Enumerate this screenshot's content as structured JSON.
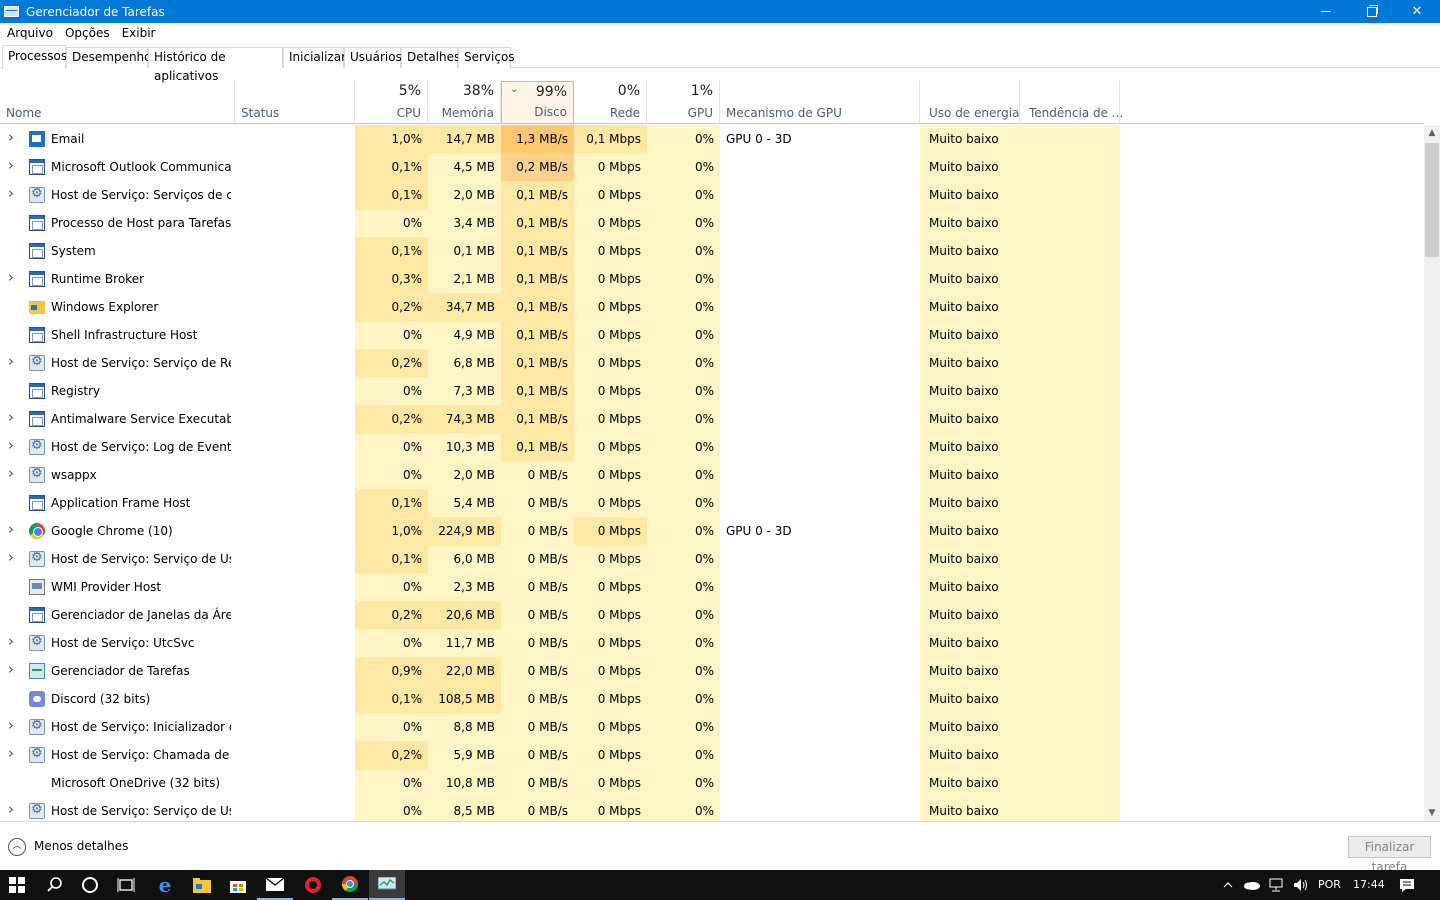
{
  "window": {
    "title": "Gerenciador de Tarefas"
  },
  "menu": [
    "Arquivo",
    "Opções",
    "Exibir"
  ],
  "tabs": [
    "Processos",
    "Desempenho",
    "Histórico de aplicativos",
    "Inicializar",
    "Usuários",
    "Detalhes",
    "Serviços"
  ],
  "active_tab": "Processos",
  "columns": {
    "name": "Nome",
    "status": "Status",
    "cpu": {
      "pct": "5%",
      "label": "CPU"
    },
    "memory": {
      "pct": "38%",
      "label": "Memória"
    },
    "disk": {
      "pct": "99%",
      "label": "Disco"
    },
    "network": {
      "pct": "0%",
      "label": "Rede"
    },
    "gpu": {
      "pct": "1%",
      "label": "GPU"
    },
    "gpu_engine": "Mecanismo de GPU",
    "power": "Uso de energia",
    "power_trend": "Tendência de ..."
  },
  "processes": [
    {
      "name": "Email",
      "icon": "mail-icon",
      "exp": true,
      "cpu": "1,0%",
      "mem": "14,7 MB",
      "disk": "1,3 MB/s",
      "net": "0,1 Mbps",
      "gpu": "0%",
      "engine": "GPU 0 - 3D",
      "power": "Muito baixo",
      "heat": {
        "cpu": 2,
        "mem": 2,
        "disk": 4,
        "net": 2
      }
    },
    {
      "name": "Microsoft Outlook Communica...",
      "icon": "window-icon",
      "exp": true,
      "cpu": "0,1%",
      "mem": "4,5 MB",
      "disk": "0,2 MB/s",
      "net": "0 Mbps",
      "gpu": "0%",
      "engine": "",
      "power": "Muito baixo",
      "heat": {
        "cpu": 2,
        "mem": 1,
        "disk": 3,
        "net": 1
      }
    },
    {
      "name": "Host de Serviço: Serviços de cri...",
      "icon": "gear-icon",
      "exp": true,
      "cpu": "0,1%",
      "mem": "2,0 MB",
      "disk": "0,1 MB/s",
      "net": "0 Mbps",
      "gpu": "0%",
      "engine": "",
      "power": "Muito baixo",
      "heat": {
        "cpu": 2,
        "mem": 1,
        "disk": 2,
        "net": 1
      }
    },
    {
      "name": "Processo de Host para Tarefas d...",
      "icon": "window-icon",
      "exp": false,
      "cpu": "0%",
      "mem": "3,4 MB",
      "disk": "0,1 MB/s",
      "net": "0 Mbps",
      "gpu": "0%",
      "engine": "",
      "power": "Muito baixo",
      "heat": {
        "cpu": 1,
        "mem": 1,
        "disk": 2,
        "net": 1
      }
    },
    {
      "name": "System",
      "icon": "window-icon",
      "exp": false,
      "cpu": "0,1%",
      "mem": "0,1 MB",
      "disk": "0,1 MB/s",
      "net": "0 Mbps",
      "gpu": "0%",
      "engine": "",
      "power": "Muito baixo",
      "heat": {
        "cpu": 2,
        "mem": 1,
        "disk": 2,
        "net": 1
      }
    },
    {
      "name": "Runtime Broker",
      "icon": "window-icon",
      "exp": true,
      "cpu": "0,3%",
      "mem": "2,1 MB",
      "disk": "0,1 MB/s",
      "net": "0 Mbps",
      "gpu": "0%",
      "engine": "",
      "power": "Muito baixo",
      "heat": {
        "cpu": 2,
        "mem": 1,
        "disk": 2,
        "net": 1
      }
    },
    {
      "name": "Windows Explorer",
      "icon": "folder-icon",
      "exp": false,
      "cpu": "0,2%",
      "mem": "34,7 MB",
      "disk": "0,1 MB/s",
      "net": "0 Mbps",
      "gpu": "0%",
      "engine": "",
      "power": "Muito baixo",
      "heat": {
        "cpu": 2,
        "mem": 2,
        "disk": 2,
        "net": 1
      }
    },
    {
      "name": "Shell Infrastructure Host",
      "icon": "window-icon",
      "exp": false,
      "cpu": "0%",
      "mem": "4,9 MB",
      "disk": "0,1 MB/s",
      "net": "0 Mbps",
      "gpu": "0%",
      "engine": "",
      "power": "Muito baixo",
      "heat": {
        "cpu": 1,
        "mem": 1,
        "disk": 2,
        "net": 1
      }
    },
    {
      "name": "Host de Serviço: Serviço de Rep...",
      "icon": "gear-icon",
      "exp": true,
      "cpu": "0,2%",
      "mem": "6,8 MB",
      "disk": "0,1 MB/s",
      "net": "0 Mbps",
      "gpu": "0%",
      "engine": "",
      "power": "Muito baixo",
      "heat": {
        "cpu": 2,
        "mem": 1,
        "disk": 2,
        "net": 1
      }
    },
    {
      "name": "Registry",
      "icon": "window-icon",
      "exp": false,
      "cpu": "0%",
      "mem": "7,3 MB",
      "disk": "0,1 MB/s",
      "net": "0 Mbps",
      "gpu": "0%",
      "engine": "",
      "power": "Muito baixo",
      "heat": {
        "cpu": 1,
        "mem": 1,
        "disk": 2,
        "net": 1
      }
    },
    {
      "name": "Antimalware Service Executable",
      "icon": "window-icon",
      "exp": true,
      "cpu": "0,2%",
      "mem": "74,3 MB",
      "disk": "0,1 MB/s",
      "net": "0 Mbps",
      "gpu": "0%",
      "engine": "",
      "power": "Muito baixo",
      "heat": {
        "cpu": 2,
        "mem": 2,
        "disk": 2,
        "net": 1
      }
    },
    {
      "name": "Host de Serviço: Log de Eventos...",
      "icon": "gear-icon",
      "exp": true,
      "cpu": "0%",
      "mem": "10,3 MB",
      "disk": "0,1 MB/s",
      "net": "0 Mbps",
      "gpu": "0%",
      "engine": "",
      "power": "Muito baixo",
      "heat": {
        "cpu": 1,
        "mem": 1,
        "disk": 2,
        "net": 1
      }
    },
    {
      "name": "wsappx",
      "icon": "gear-icon",
      "exp": true,
      "cpu": "0%",
      "mem": "2,0 MB",
      "disk": "0 MB/s",
      "net": "0 Mbps",
      "gpu": "0%",
      "engine": "",
      "power": "Muito baixo",
      "heat": {
        "cpu": 1,
        "mem": 1,
        "disk": 1,
        "net": 1
      }
    },
    {
      "name": "Application Frame Host",
      "icon": "window-icon",
      "exp": false,
      "cpu": "0,1%",
      "mem": "5,4 MB",
      "disk": "0 MB/s",
      "net": "0 Mbps",
      "gpu": "0%",
      "engine": "",
      "power": "Muito baixo",
      "heat": {
        "cpu": 2,
        "mem": 1,
        "disk": 1,
        "net": 1
      }
    },
    {
      "name": "Google Chrome (10)",
      "icon": "chrome-icon",
      "exp": true,
      "cpu": "1,0%",
      "mem": "224,9 MB",
      "disk": "0 MB/s",
      "net": "0 Mbps",
      "gpu": "0%",
      "engine": "GPU 0 - 3D",
      "power": "Muito baixo",
      "heat": {
        "cpu": 2,
        "mem": 2,
        "disk": 1,
        "net": 2
      }
    },
    {
      "name": "Host de Serviço: Serviço de Usu...",
      "icon": "gear-icon",
      "exp": true,
      "cpu": "0,1%",
      "mem": "6,0 MB",
      "disk": "0 MB/s",
      "net": "0 Mbps",
      "gpu": "0%",
      "engine": "",
      "power": "Muito baixo",
      "heat": {
        "cpu": 2,
        "mem": 1,
        "disk": 1,
        "net": 1
      }
    },
    {
      "name": "WMI Provider Host",
      "icon": "wmi-icon",
      "exp": false,
      "cpu": "0%",
      "mem": "2,3 MB",
      "disk": "0 MB/s",
      "net": "0 Mbps",
      "gpu": "0%",
      "engine": "",
      "power": "Muito baixo",
      "heat": {
        "cpu": 1,
        "mem": 1,
        "disk": 1,
        "net": 1
      }
    },
    {
      "name": "Gerenciador de Janelas da Área ...",
      "icon": "window-icon",
      "exp": false,
      "cpu": "0,2%",
      "mem": "20,6 MB",
      "disk": "0 MB/s",
      "net": "0 Mbps",
      "gpu": "0%",
      "engine": "",
      "power": "Muito baixo",
      "heat": {
        "cpu": 2,
        "mem": 2,
        "disk": 1,
        "net": 1
      }
    },
    {
      "name": "Host de Serviço: UtcSvc",
      "icon": "gear-icon",
      "exp": true,
      "cpu": "0%",
      "mem": "11,7 MB",
      "disk": "0 MB/s",
      "net": "0 Mbps",
      "gpu": "0%",
      "engine": "",
      "power": "Muito baixo",
      "heat": {
        "cpu": 1,
        "mem": 1,
        "disk": 1,
        "net": 1
      }
    },
    {
      "name": "Gerenciador de Tarefas",
      "icon": "taskmgr-icon",
      "exp": true,
      "cpu": "0,9%",
      "mem": "22,0 MB",
      "disk": "0 MB/s",
      "net": "0 Mbps",
      "gpu": "0%",
      "engine": "",
      "power": "Muito baixo",
      "heat": {
        "cpu": 2,
        "mem": 2,
        "disk": 1,
        "net": 1
      }
    },
    {
      "name": "Discord (32 bits)",
      "icon": "discord-icon",
      "exp": false,
      "cpu": "0,1%",
      "mem": "108,5 MB",
      "disk": "0 MB/s",
      "net": "0 Mbps",
      "gpu": "0%",
      "engine": "",
      "power": "Muito baixo",
      "heat": {
        "cpu": 2,
        "mem": 2,
        "disk": 1,
        "net": 1
      }
    },
    {
      "name": "Host de Serviço: Inicializador de...",
      "icon": "gear-icon",
      "exp": true,
      "cpu": "0%",
      "mem": "8,8 MB",
      "disk": "0 MB/s",
      "net": "0 Mbps",
      "gpu": "0%",
      "engine": "",
      "power": "Muito baixo",
      "heat": {
        "cpu": 1,
        "mem": 1,
        "disk": 1,
        "net": 1
      }
    },
    {
      "name": "Host de Serviço: Chamada de Pr...",
      "icon": "gear-icon",
      "exp": true,
      "cpu": "0,2%",
      "mem": "5,9 MB",
      "disk": "0 MB/s",
      "net": "0 Mbps",
      "gpu": "0%",
      "engine": "",
      "power": "Muito baixo",
      "heat": {
        "cpu": 2,
        "mem": 1,
        "disk": 1,
        "net": 1
      }
    },
    {
      "name": "Microsoft OneDrive (32 bits)",
      "icon": "",
      "exp": false,
      "cpu": "0%",
      "mem": "10,8 MB",
      "disk": "0 MB/s",
      "net": "0 Mbps",
      "gpu": "0%",
      "engine": "",
      "power": "Muito baixo",
      "heat": {
        "cpu": 1,
        "mem": 1,
        "disk": 1,
        "net": 1
      }
    },
    {
      "name": "Host de Serviço: Serviço de Usu...",
      "icon": "gear-icon",
      "exp": true,
      "cpu": "0%",
      "mem": "8,5 MB",
      "disk": "0 MB/s",
      "net": "0 Mbps",
      "gpu": "0%",
      "engine": "",
      "power": "Muito baixo",
      "heat": {
        "cpu": 1,
        "mem": 1,
        "disk": 1,
        "net": 1
      }
    }
  ],
  "footer": {
    "fewer_details": "Menos detalhes",
    "end_task": "Finalizar tarefa"
  },
  "taskbar": {
    "language": "POR",
    "time": "17:44"
  }
}
